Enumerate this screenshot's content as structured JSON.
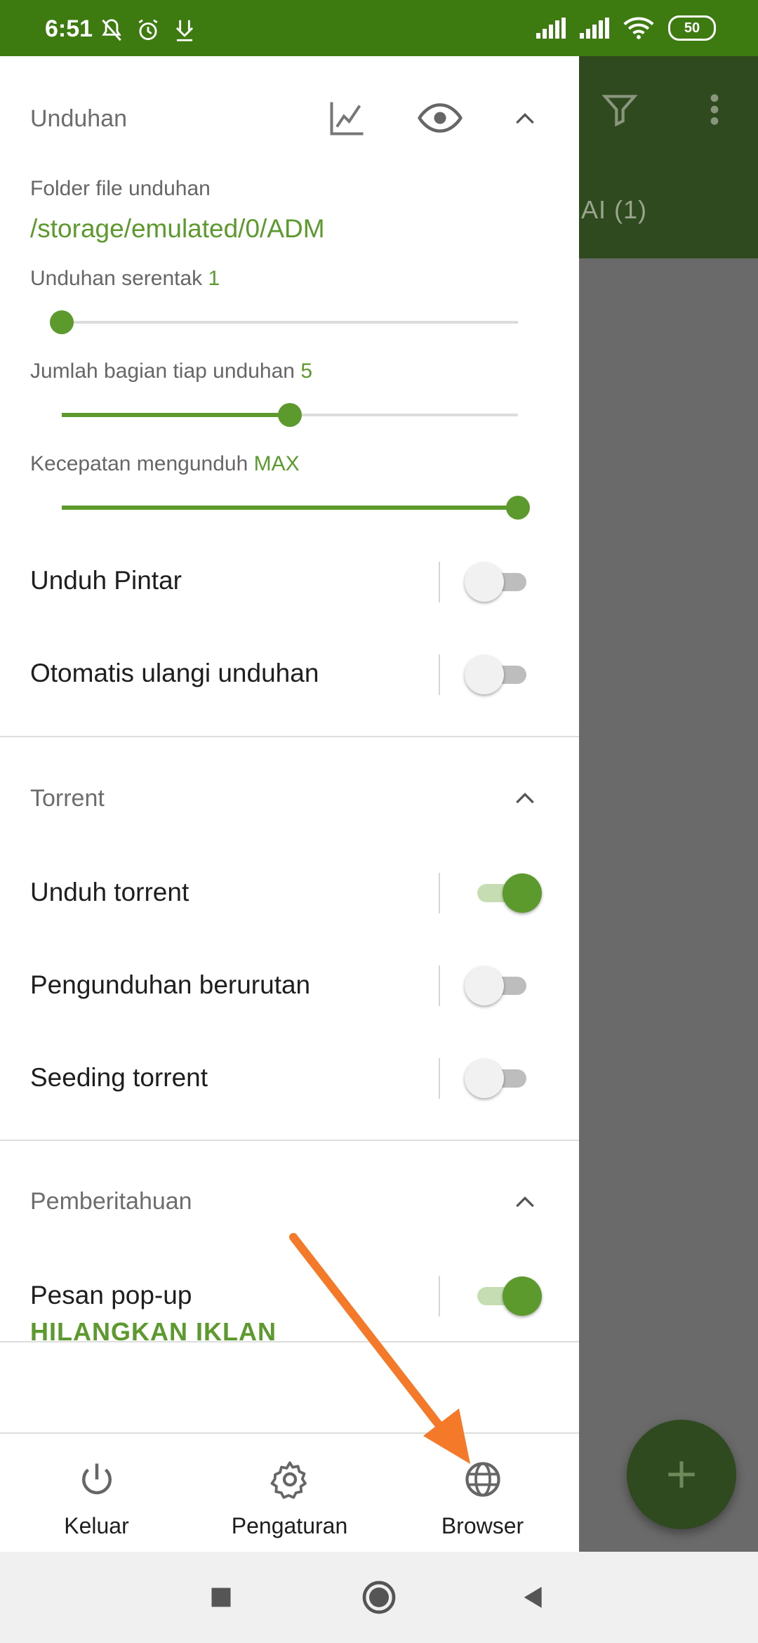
{
  "status_bar": {
    "time": "6:51",
    "battery": "50"
  },
  "background_app": {
    "tab_label": "AI (1)"
  },
  "drawer": {
    "downloads": {
      "title": "Unduhan",
      "folder_label": "Folder file unduhan",
      "folder_path": "/storage/emulated/0/ADM",
      "concurrent": {
        "label": "Unduhan serentak",
        "value": "1",
        "level": 0.0
      },
      "parts": {
        "label": "Jumlah bagian tiap unduhan",
        "value": "5",
        "level": 0.5
      },
      "speed": {
        "label": "Kecepatan mengunduh",
        "value": "MAX",
        "level": 1.0
      },
      "smart_download": {
        "label": "Unduh Pintar",
        "on": false
      },
      "auto_retry": {
        "label": "Otomatis ulangi unduhan",
        "on": false
      }
    },
    "torrent": {
      "title": "Torrent",
      "download_torrent": {
        "label": "Unduh torrent",
        "on": true
      },
      "sequential": {
        "label": "Pengunduhan berurutan",
        "on": false
      },
      "seeding": {
        "label": "Seeding torrent",
        "on": false
      }
    },
    "notifications": {
      "title": "Pemberitahuan",
      "popup": {
        "label": "Pesan pop-up",
        "on": true
      }
    },
    "remove_ads": "HILANGKAN IKLAN",
    "bottom_nav": {
      "exit": "Keluar",
      "settings": "Pengaturan",
      "browser": "Browser"
    }
  },
  "colors": {
    "accent": "#5d9a2d",
    "status_bar": "#3d7a10",
    "arrow": "#f47a2a"
  }
}
